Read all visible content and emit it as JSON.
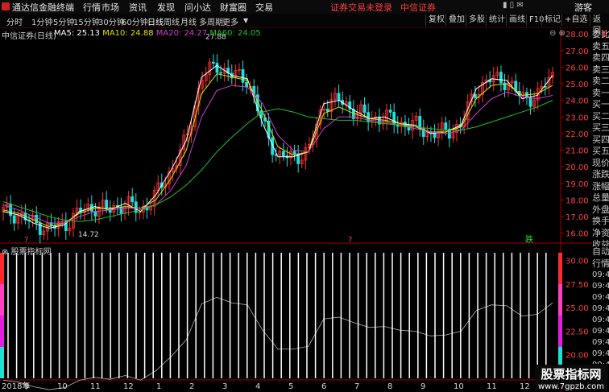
{
  "app": {
    "title": "通达信金融终端",
    "user_label": "游客"
  },
  "menu": [
    "行情",
    "市场",
    "资讯",
    "发现",
    "问小达",
    "财富圈",
    "交易"
  ],
  "notice": {
    "text": "证券交易未登录",
    "broker": "中信证券"
  },
  "period_tabs": [
    "分时",
    "1分钟",
    "5分钟",
    "15分钟",
    "30分钟",
    "60分钟",
    "日线",
    "周线",
    "月线",
    "多周期",
    "更多"
  ],
  "active_tab": "日线",
  "right_tools": [
    "复权",
    "叠加",
    "多股",
    "统计",
    "画线",
    "F10",
    "标记",
    "+自选",
    "返回"
  ],
  "stock": {
    "name": "中信证券(日线)"
  },
  "ma_legend": [
    {
      "label": "MA5: 25.13",
      "color": "#ffffff"
    },
    {
      "label": "MA10: 24.88",
      "color": "#e0e000"
    },
    {
      "label": "MA20: 24.27",
      "color": "#d040d0"
    },
    {
      "label": "MA60: 24.05",
      "color": "#20c020"
    }
  ],
  "price_axis": [
    "28.00",
    "27.00",
    "26.00",
    "25.00",
    "24.00",
    "23.00",
    "22.00",
    "21.00",
    "20.00",
    "19.00",
    "18.00",
    "17.00",
    "16.00"
  ],
  "annotations": {
    "high": "27.88",
    "low": "14.72"
  },
  "signal_marks": {
    "left": "?",
    "middle": "?",
    "right": "跌"
  },
  "indicator": {
    "title": "股票指标网",
    "axis": [
      "30.00",
      "27.50",
      "25.00",
      "22.50",
      "20.00"
    ]
  },
  "x_axis": [
    "2018年",
    "9",
    "10",
    "11",
    "12",
    "1",
    "2",
    "3",
    "4",
    "5",
    "6",
    "7",
    "8",
    "9",
    "10",
    "11",
    "12"
  ],
  "side_panel": {
    "top": [
      "委比",
      "卖五",
      "卖四",
      "卖三",
      "卖二",
      "卖一",
      "买一",
      "买二",
      "买三",
      "买四",
      "买五",
      "现价",
      "涨跌",
      "涨幅",
      "总量",
      "外盘",
      "换手",
      "净资",
      "收益"
    ],
    "bottom_header": [
      "自动",
      "行情"
    ],
    "times": [
      "09:4",
      "09:4",
      "09:4",
      "09:4",
      "09:4",
      "09:4",
      "09:4",
      "09:4",
      "09:4",
      "09:4"
    ]
  },
  "colors": {
    "up": "#ff3030",
    "down": "#20e0e0",
    "ma5": "#ffffff",
    "ma10": "#e0e000",
    "ma20": "#d040d0",
    "ma60": "#20c020",
    "axis": "#a00000"
  },
  "chart_data": {
    "type": "line",
    "title": "中信证券(日线)",
    "x": [
      "2018年",
      "9",
      "10",
      "11",
      "12",
      "1",
      "2",
      "3",
      "4",
      "5",
      "6",
      "7",
      "8",
      "9",
      "10",
      "11",
      "12"
    ],
    "ylim": [
      15.5,
      28.2
    ],
    "series": [
      {
        "name": "MA5",
        "values": [
          17.3,
          17.1,
          16.6,
          16.3,
          16.5,
          17.3,
          17.6,
          17.4,
          17.8,
          17.3,
          18.3,
          19.8,
          21.6,
          25.4,
          26.1,
          25.5,
          25.3,
          22.6,
          20.6,
          20.6,
          20.9,
          23.8,
          24.0,
          23.4,
          22.9,
          23.0,
          22.6,
          22.5,
          22.0,
          22.1,
          22.5,
          24.7,
          25.3,
          25.2,
          24.1,
          24.3,
          25.5
        ]
      },
      {
        "name": "MA10",
        "values": [
          17.4,
          17.2,
          16.8,
          16.4,
          16.6,
          17.2,
          17.5,
          17.5,
          17.6,
          17.5,
          18.0,
          19.3,
          21.0,
          24.4,
          25.6,
          25.4,
          25.2,
          23.3,
          21.2,
          20.7,
          20.9,
          23.2,
          23.6,
          23.2,
          22.9,
          22.8,
          22.6,
          22.4,
          22.1,
          22.1,
          22.4,
          24.1,
          24.9,
          25.0,
          24.3,
          24.4,
          24.9
        ]
      },
      {
        "name": "MA20",
        "values": [
          17.7,
          17.4,
          17.0,
          16.6,
          16.6,
          17.0,
          17.3,
          17.4,
          17.5,
          17.5,
          17.7,
          18.6,
          20.1,
          23.0,
          24.6,
          24.9,
          24.8,
          23.8,
          21.9,
          21.0,
          20.9,
          22.3,
          23.0,
          23.0,
          22.8,
          22.7,
          22.5,
          22.3,
          22.1,
          22.0,
          22.2,
          23.2,
          24.1,
          24.5,
          24.2,
          24.1,
          24.3
        ]
      },
      {
        "name": "MA60",
        "values": [
          17.9,
          17.6,
          17.3,
          17.0,
          16.8,
          16.7,
          16.8,
          17.0,
          17.2,
          17.4,
          17.7,
          18.2,
          18.9,
          19.8,
          20.9,
          21.8,
          22.6,
          23.3,
          23.5,
          23.3,
          23.0,
          22.9,
          22.8,
          22.8,
          22.7,
          22.6,
          22.5,
          22.4,
          22.3,
          22.2,
          22.2,
          22.4,
          22.7,
          23.0,
          23.3,
          23.6,
          24.0
        ]
      }
    ]
  }
}
